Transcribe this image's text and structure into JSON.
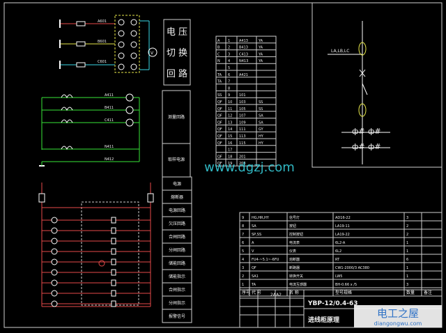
{
  "title_box": {
    "chars": [
      "电 压",
      "切 换",
      "回 路"
    ]
  },
  "measure_labels": {
    "measure_circuit": "测量回路",
    "energy_meter": "取样电源"
  },
  "right_column": [
    "电源",
    "熔断器",
    "电源回路",
    "欠压回路",
    "合闸回路",
    "分闸回路",
    "储能回路",
    "储能指示",
    "合闸指示",
    "分闸指示",
    "报警信号"
  ],
  "left_top_labels": [
    "A601",
    "B601",
    "C601"
  ],
  "bus_labels": [
    "A411",
    "B411",
    "C411",
    "N411",
    "N412"
  ],
  "single_line_label": "LA,LB,LC",
  "terminal_strip": {
    "rows": [
      {
        "l": "A",
        "n": "1",
        "w": "A413",
        "r": "YA"
      },
      {
        "l": "B",
        "n": "2",
        "w": "B413",
        "r": "YA"
      },
      {
        "l": "C",
        "n": "3",
        "w": "C413",
        "r": "YA"
      },
      {
        "l": "N",
        "n": "4",
        "w": "N413",
        "r": "YA"
      },
      {
        "l": "",
        "n": "5",
        "w": "",
        "r": ""
      },
      {
        "l": "TA",
        "n": "6",
        "w": "A421",
        "r": ""
      },
      {
        "l": "TA",
        "n": "7",
        "w": "",
        "r": ""
      },
      {
        "l": "",
        "n": "8",
        "w": "",
        "r": ""
      },
      {
        "l": "SS",
        "n": "9",
        "w": "101",
        "r": ""
      },
      {
        "l": "QF",
        "n": "10",
        "w": "103",
        "r": "SS"
      },
      {
        "l": "QF",
        "n": "11",
        "w": "105",
        "r": "SS"
      },
      {
        "l": "QF",
        "n": "12",
        "w": "107",
        "r": "SA"
      },
      {
        "l": "QF",
        "n": "13",
        "w": "109",
        "r": "SA"
      },
      {
        "l": "QF",
        "n": "14",
        "w": "111",
        "r": "GY"
      },
      {
        "l": "QF",
        "n": "15",
        "w": "113",
        "r": "HY"
      },
      {
        "l": "QF",
        "n": "16",
        "w": "115",
        "r": "HY"
      },
      {
        "l": "",
        "n": "17",
        "w": "",
        "r": ""
      },
      {
        "l": "QF",
        "n": "18",
        "w": "201",
        "r": ""
      },
      {
        "l": "QF",
        "n": "19",
        "w": "203",
        "r": ""
      }
    ]
  },
  "watermark": "www.dgzj.com",
  "parts_table": {
    "rows": [
      {
        "no": "9",
        "code": "HG,HR,HY",
        "name": "信号灯",
        "spec": "AD16-22",
        "qty": "3"
      },
      {
        "no": "8",
        "code": "SA",
        "name": "按钮",
        "spec": "LA19-11",
        "qty": "2"
      },
      {
        "no": "7",
        "code": "SP,SS",
        "name": "控制按钮",
        "spec": "LA19-22",
        "qty": "2"
      },
      {
        "no": "6",
        "code": "A",
        "name": "电流表",
        "spec": "6L2-A",
        "qty": "1"
      },
      {
        "no": "5",
        "code": "V",
        "name": "仪表",
        "spec": "6L2",
        "qty": "1"
      },
      {
        "no": "4",
        "code": "FU4-~5.1~-6FU",
        "name": "熔断器",
        "spec": "RT",
        "qty": "6"
      },
      {
        "no": "3",
        "code": "QF",
        "name": "断路器",
        "spec": "CW1-2000/3 AC380",
        "qty": "1"
      },
      {
        "no": "2",
        "code": "SA1",
        "name": "转换开关",
        "spec": "LW5",
        "qty": "1"
      },
      {
        "no": "1",
        "code": "TA",
        "name": "电流互感器",
        "spec": "BH-0.66 x /5",
        "qty": "3"
      }
    ],
    "header": {
      "no": "序号",
      "code": "代 号",
      "name": "名 称",
      "spec": "型号规格",
      "qty": "数量",
      "note": "备注"
    }
  },
  "title_block": {
    "drawing_no": "2AA2",
    "model": "YBP-12/0.4-63",
    "name": "进线柜原理"
  },
  "brand": {
    "cn": "电工之屋",
    "url": "diangongwu.com"
  }
}
